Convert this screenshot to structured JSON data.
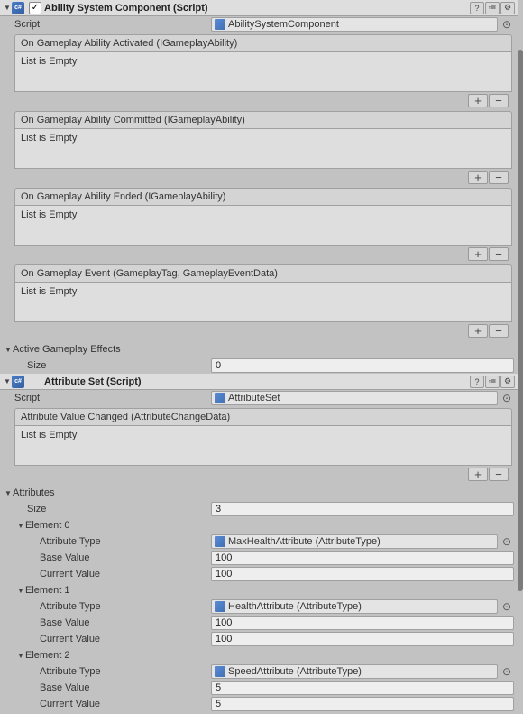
{
  "component1": {
    "title": "Ability System Component (Script)",
    "scriptLabel": "Script",
    "scriptValue": "AbilitySystemComponent",
    "events": [
      {
        "header": "On Gameplay Ability Activated (IGameplayAbility)",
        "body": "List is Empty"
      },
      {
        "header": "On Gameplay Ability Committed (IGameplayAbility)",
        "body": "List is Empty"
      },
      {
        "header": "On Gameplay Ability Ended (IGameplayAbility)",
        "body": "List is Empty"
      },
      {
        "header": "On Gameplay Event (GameplayTag, GameplayEventData)",
        "body": "List is Empty"
      }
    ],
    "activeEffectsLabel": "Active Gameplay Effects",
    "sizeLabel": "Size",
    "sizeValue": "0"
  },
  "component2": {
    "title": "Attribute Set (Script)",
    "scriptLabel": "Script",
    "scriptValue": "AttributeSet",
    "event": {
      "header": "Attribute Value Changed (AttributeChangeData)",
      "body": "List is Empty"
    },
    "attributesLabel": "Attributes",
    "sizeLabel": "Size",
    "sizeValue": "3",
    "attrTypeLabel": "Attribute Type",
    "baseLabel": "Base Value",
    "currentLabel": "Current Value",
    "elements": [
      {
        "elLabel": "Element 0",
        "type": "MaxHealthAttribute (AttributeType)",
        "base": "100",
        "current": "100"
      },
      {
        "elLabel": "Element 1",
        "type": "HealthAttribute (AttributeType)",
        "base": "100",
        "current": "100"
      },
      {
        "elLabel": "Element 2",
        "type": "SpeedAttribute (AttributeType)",
        "base": "5",
        "current": "5"
      }
    ]
  }
}
